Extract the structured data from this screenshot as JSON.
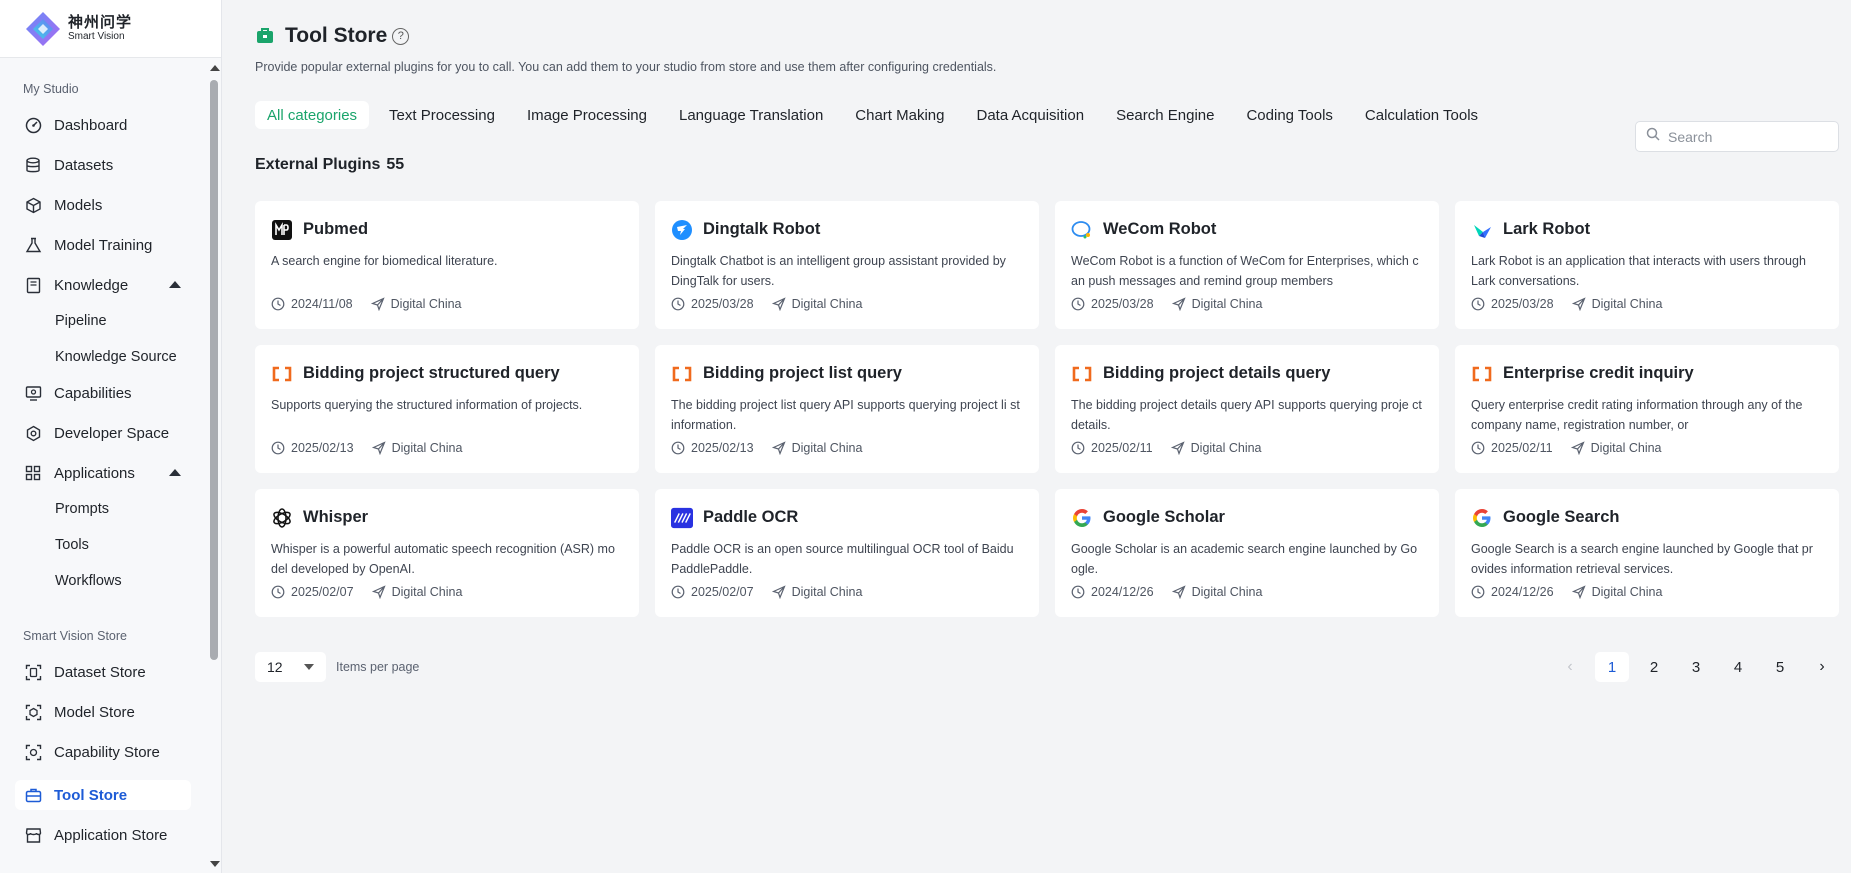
{
  "brand": {
    "name_cn": "神州问学",
    "name_en": "Smart Vision"
  },
  "sidebar": {
    "section_studio": "My Studio",
    "section_store": "Smart Vision Store",
    "items": [
      {
        "label": "Dashboard",
        "icon": "dashboard-icon"
      },
      {
        "label": "Datasets",
        "icon": "database-icon"
      },
      {
        "label": "Models",
        "icon": "cube-icon"
      },
      {
        "label": "Model Training",
        "icon": "flask-icon"
      },
      {
        "label": "Knowledge",
        "icon": "book-icon"
      },
      {
        "label": "Pipeline"
      },
      {
        "label": "Knowledge Source"
      },
      {
        "label": "Capabilities",
        "icon": "monitor-icon"
      },
      {
        "label": "Developer Space",
        "icon": "gear-icon"
      },
      {
        "label": "Applications",
        "icon": "grid-icon"
      },
      {
        "label": "Prompts"
      },
      {
        "label": "Tools"
      },
      {
        "label": "Workflows"
      },
      {
        "label": "Dataset Store",
        "icon": "dataset-store-icon"
      },
      {
        "label": "Model Store",
        "icon": "model-store-icon"
      },
      {
        "label": "Capability Store",
        "icon": "capability-store-icon"
      },
      {
        "label": "Tool Store",
        "icon": "toolbox-icon"
      },
      {
        "label": "Application Store",
        "icon": "shop-icon"
      }
    ]
  },
  "header": {
    "title": "Tool Store",
    "subtitle": "Provide popular external plugins for you to call. You can add them to your studio from store and use them after configuring credentials."
  },
  "tabs": [
    "All categories",
    "Text Processing",
    "Image Processing",
    "Language Translation",
    "Chart Making",
    "Data Acquisition",
    "Search Engine",
    "Coding Tools",
    "Calculation Tools"
  ],
  "search": {
    "placeholder": "Search"
  },
  "plugins_header": {
    "label": "External Plugins",
    "count": "55"
  },
  "cards": [
    {
      "title": "Pubmed",
      "desc": "A search engine for biomedical literature.",
      "date": "2024/11/08",
      "author": "Digital China",
      "icon": "pubmed-icon"
    },
    {
      "title": "Dingtalk Robot",
      "desc": "Dingtalk Chatbot is an intelligent group assistant provided by DingTalk for users.",
      "date": "2025/03/28",
      "author": "Digital China",
      "icon": "dingtalk-icon"
    },
    {
      "title": "WeCom Robot",
      "desc": "WeCom Robot is a function of WeCom for Enterprises, which c an push messages and remind group members",
      "date": "2025/03/28",
      "author": "Digital China",
      "icon": "wecom-icon"
    },
    {
      "title": "Lark Robot",
      "desc": "Lark Robot is an application that interacts with users through Lark conversations.",
      "date": "2025/03/28",
      "author": "Digital China",
      "icon": "lark-icon"
    },
    {
      "title": "Bidding project structured query",
      "desc": "Supports querying the structured information of projects.",
      "date": "2025/02/13",
      "author": "Digital China",
      "icon": "bracket-icon"
    },
    {
      "title": "Bidding project list query",
      "desc": "The bidding project list query API supports querying project li st information.",
      "date": "2025/02/13",
      "author": "Digital China",
      "icon": "bracket-icon"
    },
    {
      "title": "Bidding project details query",
      "desc": "The bidding project details query API supports querying proje ct details.",
      "date": "2025/02/11",
      "author": "Digital China",
      "icon": "bracket-icon"
    },
    {
      "title": "Enterprise credit inquiry",
      "desc": "Query enterprise credit rating information through any of the company name, registration number, or",
      "date": "2025/02/11",
      "author": "Digital China",
      "icon": "bracket-icon"
    },
    {
      "title": "Whisper",
      "desc": "Whisper is a powerful automatic speech recognition (ASR) mo del developed by OpenAI.",
      "date": "2025/02/07",
      "author": "Digital China",
      "icon": "openai-icon"
    },
    {
      "title": "Paddle OCR",
      "desc": "Paddle OCR is an open source multilingual OCR tool of Baidu PaddlePaddle.",
      "date": "2025/02/07",
      "author": "Digital China",
      "icon": "paddle-icon"
    },
    {
      "title": "Google Scholar",
      "desc": "Google Scholar is an academic search engine launched by Go ogle.",
      "date": "2024/12/26",
      "author": "Digital China",
      "icon": "google-icon"
    },
    {
      "title": "Google Search",
      "desc": "Google Search is a search engine launched by Google that pr ovides information retrieval services.",
      "date": "2024/12/26",
      "author": "Digital China",
      "icon": "google-icon"
    }
  ],
  "pagination": {
    "page_size": "12",
    "items_per_page_label": "Items per page",
    "pages": [
      "1",
      "2",
      "3",
      "4",
      "5"
    ],
    "current": "1"
  },
  "colors": {
    "accent_green": "#1aa46b",
    "active_blue": "#1d5bd6",
    "bracket_orange": "#f06a1d"
  }
}
